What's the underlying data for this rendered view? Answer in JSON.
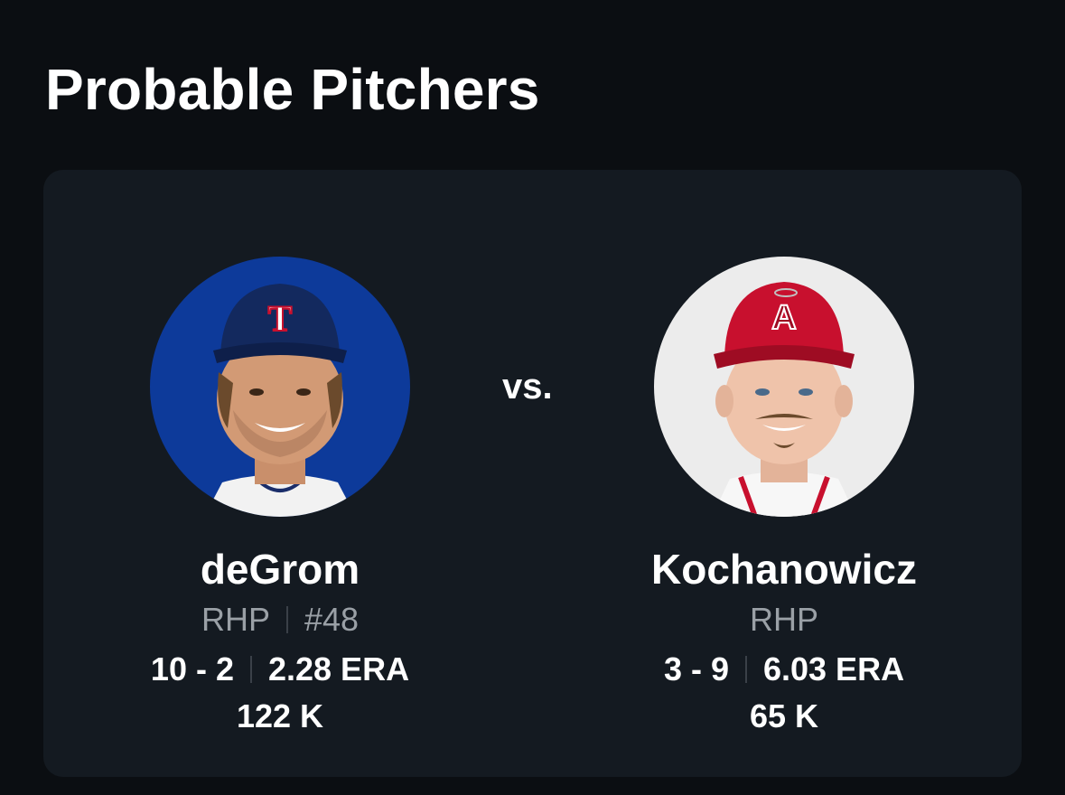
{
  "page": {
    "title": "Probable Pitchers"
  },
  "matchup": {
    "vs_label": "vs.",
    "away": {
      "name": "deGrom",
      "position": "RHP",
      "number": "#48",
      "record": "10 - 2",
      "era": "2.28 ERA",
      "strikeouts": "122 K",
      "photo_bg": "#0d3a9a",
      "cap_color": "#13295e"
    },
    "home": {
      "name": "Kochanowicz",
      "position": "RHP",
      "record": "3 - 9",
      "era": "6.03 ERA",
      "strikeouts": "65 K",
      "photo_bg": "#ececec",
      "cap_color": "#c8102e"
    }
  }
}
